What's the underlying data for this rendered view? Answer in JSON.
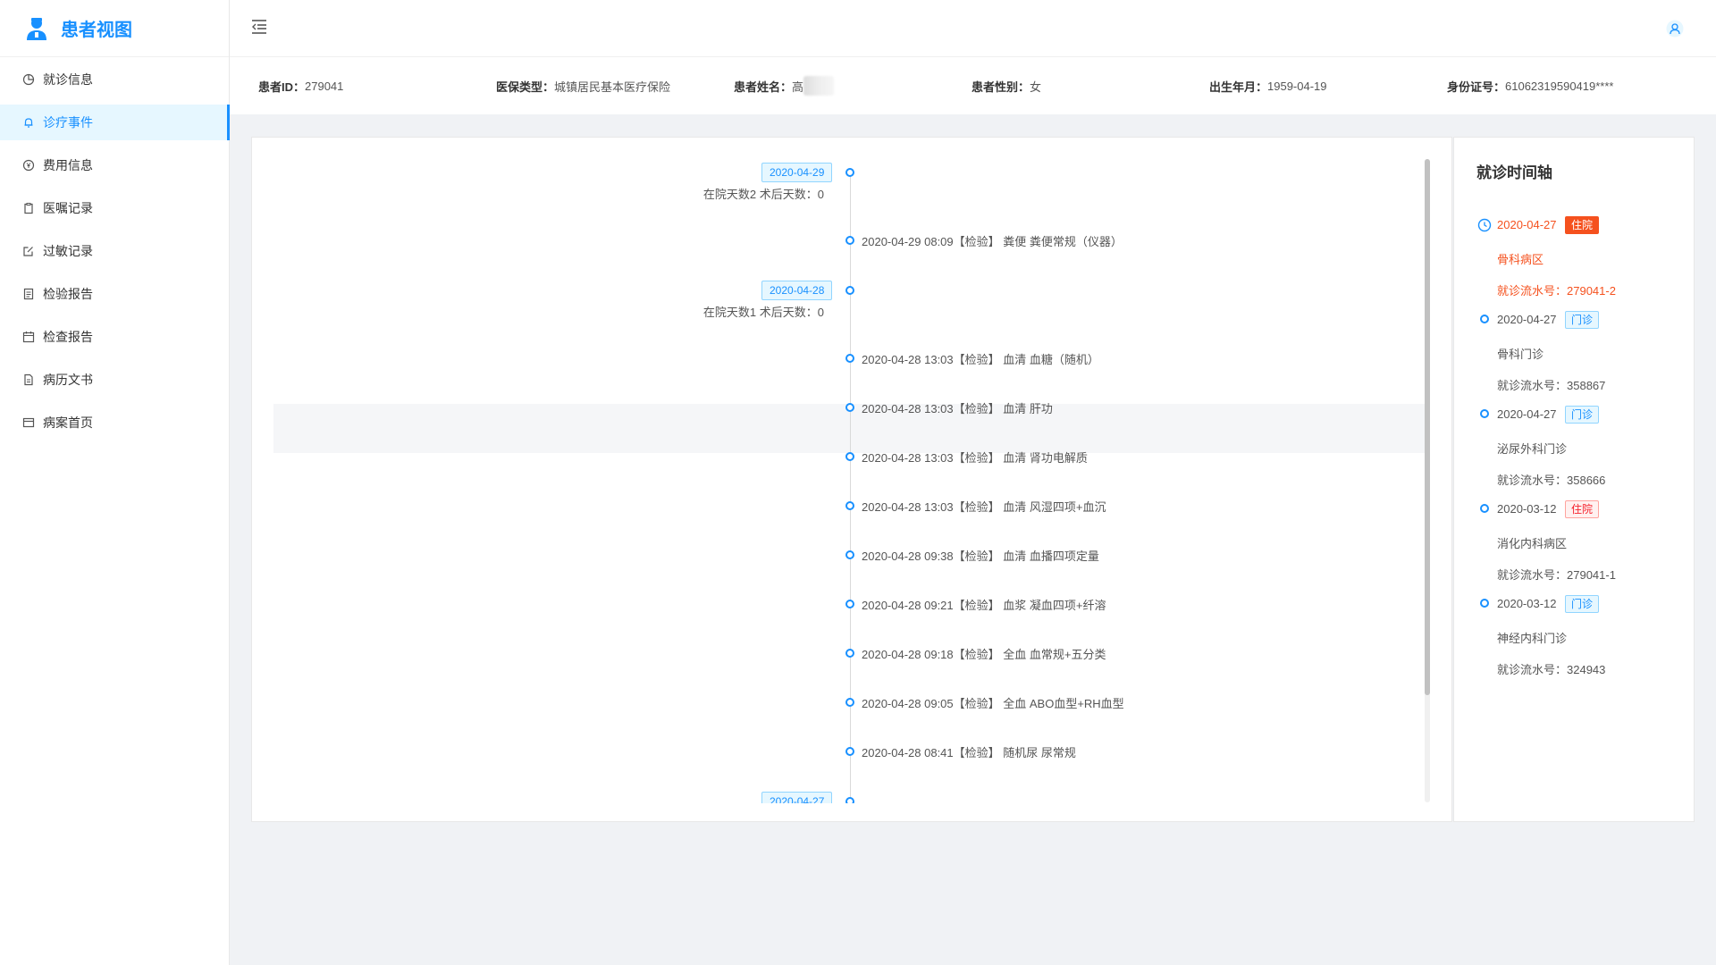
{
  "app": {
    "title": "患者视图"
  },
  "sidebar": {
    "items": [
      {
        "label": "就诊信息",
        "icon": "pie-chart-icon"
      },
      {
        "label": "诊疗事件",
        "icon": "bell-icon",
        "active": true
      },
      {
        "label": "费用信息",
        "icon": "yen-icon"
      },
      {
        "label": "医嘱记录",
        "icon": "clipboard-icon"
      },
      {
        "label": "过敏记录",
        "icon": "edit-icon"
      },
      {
        "label": "检验报告",
        "icon": "report-icon"
      },
      {
        "label": "检查报告",
        "icon": "calendar-icon"
      },
      {
        "label": "病历文书",
        "icon": "document-icon"
      },
      {
        "label": "病案首页",
        "icon": "card-icon"
      }
    ]
  },
  "patient": {
    "id_label": "患者ID：",
    "id": "279041",
    "insurance_label": "医保类型：",
    "insurance": "城镇居民基本医疗保险",
    "name_label": "患者姓名：",
    "name": "高",
    "gender_label": "患者性别：",
    "gender": "女",
    "birth_label": "出生年月：",
    "birth": "1959-04-19",
    "idcard_label": "身份证号：",
    "idcard": "61062319590419****"
  },
  "timeline": {
    "groups": [
      {
        "date": "2020-04-29",
        "info": "在院天数2 术后天数：0"
      },
      {
        "date": "2020-04-28",
        "info": "在院天数1 术后天数：0"
      },
      {
        "date": "2020-04-27",
        "info": ""
      }
    ],
    "events": [
      "2020-04-29 08:09【检验】 粪便 粪便常规（仪器）",
      "2020-04-28 13:03【检验】 血清 血糖（随机）",
      "2020-04-28 13:03【检验】 血清 肝功",
      "2020-04-28 13:03【检验】 血清 肾功电解质",
      "2020-04-28 13:03【检验】 血清 风湿四项+血沉",
      "2020-04-28 09:38【检验】 血清 血播四项定量",
      "2020-04-28 09:21【检验】 血浆 凝血四项+纤溶",
      "2020-04-28 09:18【检验】 全血 血常规+五分类",
      "2020-04-28 09:05【检验】 全血 ABO血型+RH血型",
      "2020-04-28 08:41【检验】 随机尿 尿常规"
    ]
  },
  "visit_timeline": {
    "title": "就诊时间轴",
    "visits": [
      {
        "date": "2020-04-27",
        "tag": "住院",
        "dept": "骨科病区",
        "serial": "就诊流水号：279041-2",
        "current": true
      },
      {
        "date": "2020-04-27",
        "tag": "门诊",
        "dept": "骨科门诊",
        "serial": "就诊流水号：358867"
      },
      {
        "date": "2020-04-27",
        "tag": "门诊",
        "dept": "泌尿外科门诊",
        "serial": "就诊流水号：358666"
      },
      {
        "date": "2020-03-12",
        "tag": "住院",
        "dept": "消化内科病区",
        "serial": "就诊流水号：279041-1"
      },
      {
        "date": "2020-03-12",
        "tag": "门诊",
        "dept": "神经内科门诊",
        "serial": "就诊流水号：324943"
      }
    ]
  },
  "colors": {
    "primary": "#1890ff",
    "accent_red": "#f5511e"
  }
}
